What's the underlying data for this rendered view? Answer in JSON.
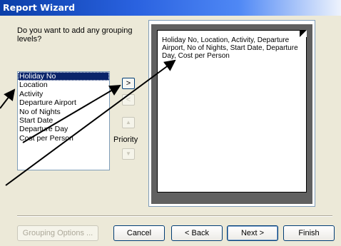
{
  "window": {
    "title": "Report Wizard"
  },
  "question": "Do you want to add any grouping levels?",
  "fields": [
    "Holiday No",
    "Location",
    "Activity",
    "Departure Airport",
    "No of Nights",
    "Start Date",
    "Departure Day",
    "Cost per Person"
  ],
  "selected_field": "Holiday No",
  "controls": {
    "add_label": ">",
    "remove_label": "<",
    "priority_up_label": "▲",
    "priority_down_label": "▼",
    "priority_label": "Priority"
  },
  "preview": {
    "text": "Holiday No, Location, Activity, Departure Airport, No of Nights, Start Date, Departure Day, Cost per Person"
  },
  "buttons": {
    "grouping_options": "Grouping Options ...",
    "cancel": "Cancel",
    "back": "< Back",
    "next": "Next >",
    "finish": "Finish"
  }
}
